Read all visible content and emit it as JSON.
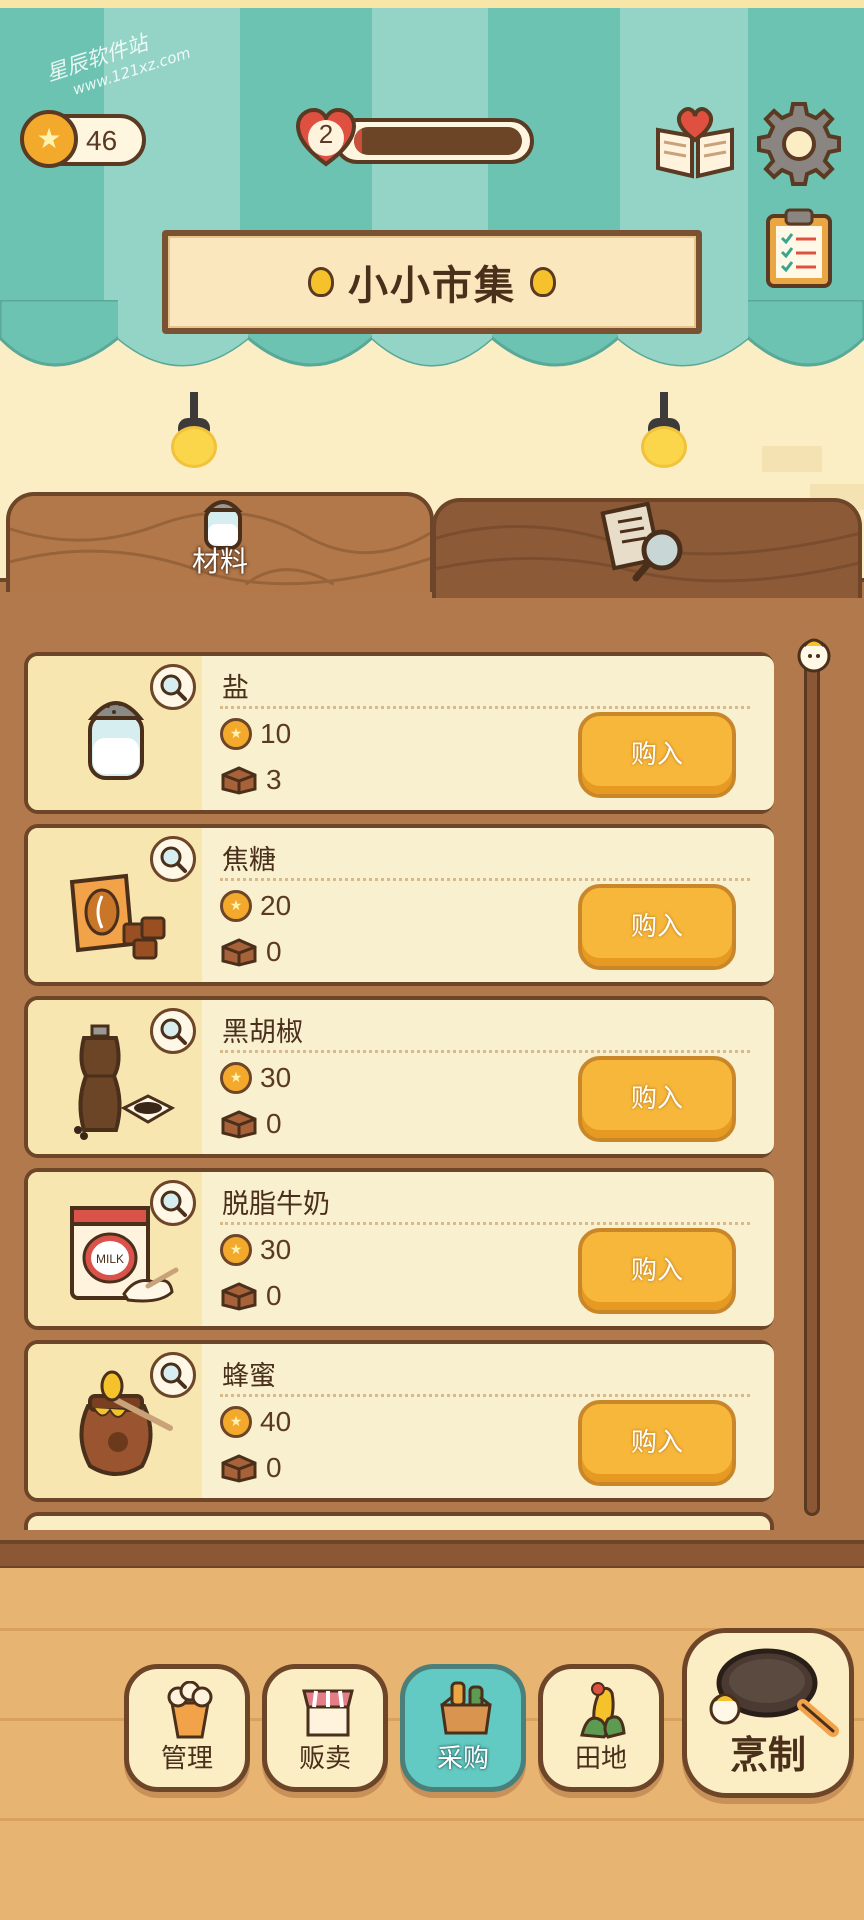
{
  "watermark": {
    "name": "星辰软件站",
    "url": "www.121xz.com"
  },
  "header": {
    "coins": "46",
    "level": "2",
    "level_progress": 0.05,
    "book_icon": "recipe-book-heart-icon",
    "settings_icon": "gear-icon",
    "tasks_icon": "clipboard-checklist-icon"
  },
  "shop": {
    "title": "小小市集"
  },
  "tabs": [
    {
      "label": "材料",
      "icon": "salt-shaker-icon",
      "active": true
    },
    {
      "label": "",
      "icon": "newspaper-magnifier-icon",
      "active": false
    }
  ],
  "items": [
    {
      "name": "盐",
      "price": "10",
      "stock": "3",
      "buy_label": "购入",
      "icon": "salt-shaker-icon"
    },
    {
      "name": "焦糖",
      "price": "20",
      "stock": "0",
      "buy_label": "购入",
      "icon": "caramel-box-icon"
    },
    {
      "name": "黑胡椒",
      "price": "30",
      "stock": "0",
      "buy_label": "购入",
      "icon": "pepper-grinder-icon"
    },
    {
      "name": "脱脂牛奶",
      "price": "30",
      "stock": "0",
      "buy_label": "购入",
      "icon": "milk-powder-can-icon"
    },
    {
      "name": "蜂蜜",
      "price": "40",
      "stock": "0",
      "buy_label": "购入",
      "icon": "honey-pot-icon"
    }
  ],
  "milk_can_text": "MILK",
  "nav": [
    {
      "label": "管理",
      "icon": "popcorn-bucket-icon",
      "active": false
    },
    {
      "label": "贩卖",
      "icon": "shop-stall-icon",
      "active": false
    },
    {
      "label": "采购",
      "icon": "supply-box-icon",
      "active": true
    },
    {
      "label": "田地",
      "icon": "corn-icon",
      "active": false
    }
  ],
  "cook": {
    "label": "烹制",
    "icon": "frying-pan-icon"
  },
  "colors": {
    "awning_teal": "#6cc3b2",
    "awning_light": "#9ad7c9",
    "buy_button": "#f6b73a",
    "active_nav": "#63c9c3",
    "wood": "#b27a4c"
  }
}
